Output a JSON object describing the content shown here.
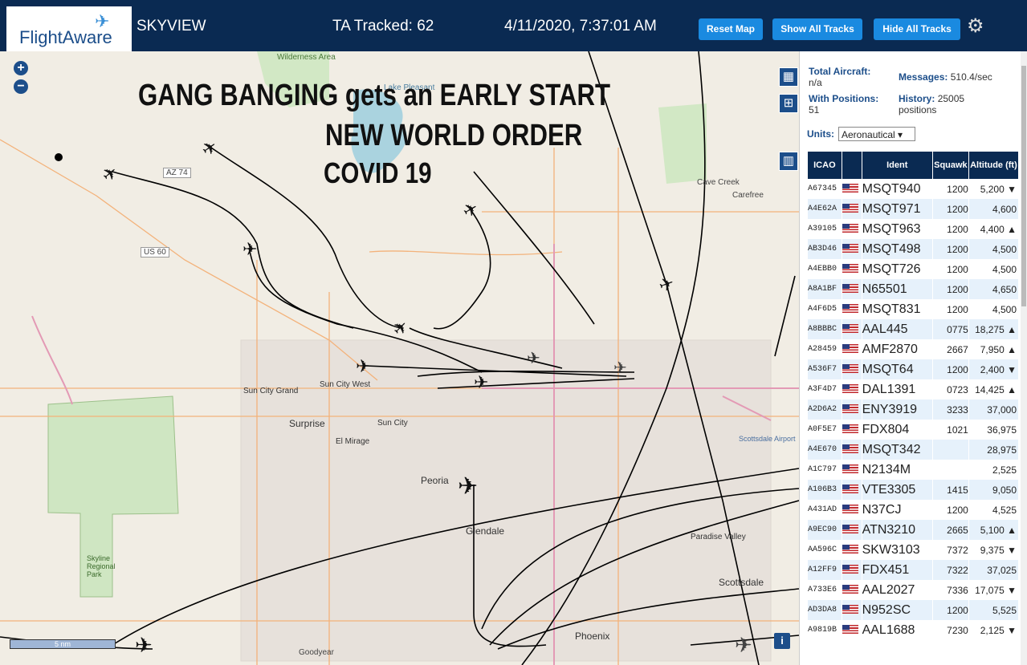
{
  "header": {
    "logo": "FlightAware",
    "title": "SKYVIEW",
    "tracked": "TA Tracked: 62",
    "datetime": "4/11/2020, 7:37:01 AM",
    "buttons": {
      "reset": "Reset Map",
      "show": "Show All Tracks",
      "hide": "Hide All Tracks"
    },
    "accent": "#1a8ae0",
    "bg": "#0a2a52"
  },
  "map": {
    "zoom_in": "+",
    "zoom_out": "−",
    "overlay_text": [
      "GANG BANGING gets an EARLY START",
      "NEW WORLD ORDER",
      "COVID 19"
    ],
    "places": [
      "Wilderness Area",
      "Lake Pleasant",
      "Cave Creek",
      "Carefree",
      "Sun City Grand",
      "Sun City West",
      "Surprise",
      "Sun City",
      "El Mirage",
      "Peoria",
      "Glendale",
      "Paradise Valley",
      "Scottsdale",
      "Scottsdale Airport",
      "Skyline Regional Park",
      "Phoenix",
      "Goodyear"
    ],
    "road_labels": [
      "AZ 74",
      "US 60"
    ],
    "scale": "5 nm",
    "info": "i"
  },
  "panel": {
    "total_aircraft_label": "Total Aircraft:",
    "total_aircraft_value": "n/a",
    "messages_label": "Messages:",
    "messages_value": "510.4/sec",
    "with_positions_label": "With Positions:",
    "with_positions_value": "51",
    "history_label": "History:",
    "history_value": "25005",
    "history_unit": "positions",
    "units_label": "Units:",
    "units_value": "Aeronautical ▾",
    "columns": [
      "ICAO",
      "",
      "Ident",
      "Squawk",
      "Altitude (ft)"
    ],
    "rows": [
      {
        "icao": "A67345",
        "ident": "MSQT940",
        "squawk": "1200",
        "alt": "5,200 ▼"
      },
      {
        "icao": "A4E62A",
        "ident": "MSQT971",
        "squawk": "1200",
        "alt": "4,600"
      },
      {
        "icao": "A39105",
        "ident": "MSQT963",
        "squawk": "1200",
        "alt": "4,400 ▲"
      },
      {
        "icao": "AB3D46",
        "ident": "MSQT498",
        "squawk": "1200",
        "alt": "4,500"
      },
      {
        "icao": "A4EBB0",
        "ident": "MSQT726",
        "squawk": "1200",
        "alt": "4,500"
      },
      {
        "icao": "A8A1BF",
        "ident": "N65501",
        "squawk": "1200",
        "alt": "4,650"
      },
      {
        "icao": "A4F6D5",
        "ident": "MSQT831",
        "squawk": "1200",
        "alt": "4,500"
      },
      {
        "icao": "A8BBBC",
        "ident": "AAL445",
        "squawk": "0775",
        "alt": "18,275 ▲"
      },
      {
        "icao": "A28459",
        "ident": "AMF2870",
        "squawk": "2667",
        "alt": "7,950 ▲"
      },
      {
        "icao": "A536F7",
        "ident": "MSQT64",
        "squawk": "1200",
        "alt": "2,400 ▼"
      },
      {
        "icao": "A3F4D7",
        "ident": "DAL1391",
        "squawk": "0723",
        "alt": "14,425 ▲"
      },
      {
        "icao": "A2D6A2",
        "ident": "ENY3919",
        "squawk": "3233",
        "alt": "37,000"
      },
      {
        "icao": "A0F5E7",
        "ident": "FDX804",
        "squawk": "1021",
        "alt": "36,975"
      },
      {
        "icao": "A4E670",
        "ident": "MSQT342",
        "squawk": "",
        "alt": "28,975"
      },
      {
        "icao": "A1C797",
        "ident": "N2134M",
        "squawk": "",
        "alt": "2,525"
      },
      {
        "icao": "A106B3",
        "ident": "VTE3305",
        "squawk": "1415",
        "alt": "9,050"
      },
      {
        "icao": "A431AD",
        "ident": "N37CJ",
        "squawk": "1200",
        "alt": "4,525"
      },
      {
        "icao": "A9EC90",
        "ident": "ATN3210",
        "squawk": "2665",
        "alt": "5,100 ▲"
      },
      {
        "icao": "AA596C",
        "ident": "SKW3103",
        "squawk": "7372",
        "alt": "9,375 ▼"
      },
      {
        "icao": "A12FF9",
        "ident": "FDX451",
        "squawk": "7322",
        "alt": "37,025"
      },
      {
        "icao": "A733E6",
        "ident": "AAL2027",
        "squawk": "7336",
        "alt": "17,075 ▼"
      },
      {
        "icao": "AD3DA8",
        "ident": "N952SC",
        "squawk": "1200",
        "alt": "5,525"
      },
      {
        "icao": "A9819B",
        "ident": "AAL1688",
        "squawk": "7230",
        "alt": "2,125 ▼"
      }
    ]
  }
}
